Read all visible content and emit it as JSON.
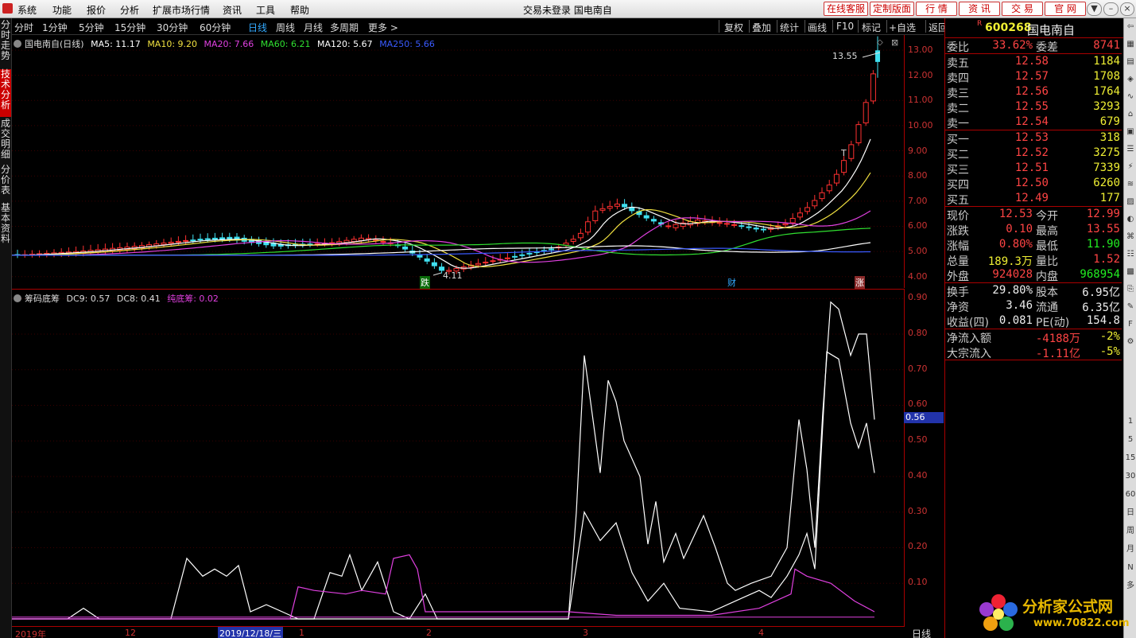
{
  "menubar": {
    "items": [
      "系统",
      "功能",
      "报价",
      "分析",
      "扩展市场行情",
      "资讯",
      "工具",
      "帮助"
    ],
    "title": "交易未登录  国电南自",
    "buttons": [
      "在线客服",
      "定制版面",
      "行 情",
      "资 讯",
      "交 易",
      "官 网"
    ]
  },
  "left_tabs": [
    "分时走势",
    "技术分析",
    "成交明细",
    "分价表",
    "基本资料"
  ],
  "periods": [
    "分时",
    "1分钟",
    "5分钟",
    "15分钟",
    "30分钟",
    "60分钟",
    "日线",
    "周线",
    "月线",
    "多周期",
    "更多 >"
  ],
  "active_period": "日线",
  "right_tools": [
    "复权",
    "叠加",
    "统计",
    "画线",
    "F10",
    "标记",
    "+自选",
    "返回"
  ],
  "price_chart": {
    "legend": {
      "name": "国电南自(日线)",
      "ma": [
        {
          "label": "MA5: 11.17",
          "color": "#ffffff"
        },
        {
          "label": "MA10: 9.20",
          "color": "#f0e040"
        },
        {
          "label": "MA20: 7.66",
          "color": "#e040e0"
        },
        {
          "label": "MA60: 6.21",
          "color": "#30e030"
        },
        {
          "label": "MA120: 5.67",
          "color": "#ffffff"
        },
        {
          "label": "MA250: 5.66",
          "color": "#3a5aff"
        }
      ]
    },
    "y_ticks": [
      "13.00",
      "12.00",
      "11.00",
      "10.00",
      "9.00",
      "8.00",
      "7.00",
      "6.00",
      "5.00",
      "4.00"
    ],
    "high_label": "13.55",
    "low_label": "4.11",
    "markers": [
      "跌",
      "财",
      "涨"
    ],
    "t_marker": "T"
  },
  "indicator": {
    "legend": [
      {
        "label": "筹码底筹",
        "color": "#dddddd"
      },
      {
        "label": "DC9: 0.57",
        "color": "#dddddd"
      },
      {
        "label": "DC8: 0.41",
        "color": "#dddddd"
      },
      {
        "label": "纯底筹: 0.02",
        "color": "#e040e0"
      }
    ],
    "y_ticks": [
      "0.90",
      "0.80",
      "0.70",
      "0.60",
      "0.50",
      "0.40",
      "0.30",
      "0.20",
      "0.10"
    ],
    "cursor_value": "0.56"
  },
  "dates": {
    "labels": [
      "2019年",
      "12",
      "1",
      "2",
      "3",
      "4"
    ],
    "cursor": "2019/12/18/三",
    "period_label": "日线"
  },
  "quote": {
    "code": "600268",
    "name": "国电南自",
    "wei_bi": {
      "label": "委比",
      "value": "33.62%",
      "label2": "委差",
      "value2": "8741"
    },
    "asks": [
      {
        "label": "卖五",
        "price": "12.58",
        "vol": "1184"
      },
      {
        "label": "卖四",
        "price": "12.57",
        "vol": "1708"
      },
      {
        "label": "卖三",
        "price": "12.56",
        "vol": "1764"
      },
      {
        "label": "卖二",
        "price": "12.55",
        "vol": "3293"
      },
      {
        "label": "卖一",
        "price": "12.54",
        "vol": "679"
      }
    ],
    "bids": [
      {
        "label": "买一",
        "price": "12.53",
        "vol": "318"
      },
      {
        "label": "买二",
        "price": "12.52",
        "vol": "3275"
      },
      {
        "label": "买三",
        "price": "12.51",
        "vol": "7339"
      },
      {
        "label": "买四",
        "price": "12.50",
        "vol": "6260"
      },
      {
        "label": "买五",
        "price": "12.49",
        "vol": "177"
      }
    ],
    "stats": [
      {
        "l1": "现价",
        "v1": "12.53",
        "c1": "red",
        "l2": "今开",
        "v2": "12.99",
        "c2": "red"
      },
      {
        "l1": "涨跌",
        "v1": "0.10",
        "c1": "red",
        "l2": "最高",
        "v2": "13.55",
        "c2": "red"
      },
      {
        "l1": "涨幅",
        "v1": "0.80%",
        "c1": "red",
        "l2": "最低",
        "v2": "11.90",
        "c2": "green"
      },
      {
        "l1": "总量",
        "v1": "189.3万",
        "c1": "yellow",
        "l2": "量比",
        "v2": "1.52",
        "c2": "red"
      },
      {
        "l1": "外盘",
        "v1": "924028",
        "c1": "red",
        "l2": "内盘",
        "v2": "968954",
        "c2": "green"
      }
    ],
    "fin": [
      {
        "l1": "换手",
        "v1": "29.80%",
        "l2": "股本",
        "v2": "6.95亿"
      },
      {
        "l1": "净资",
        "v1": "3.46",
        "l2": "流通",
        "v2": "6.35亿"
      },
      {
        "l1": "收益(四)",
        "v1": "0.081",
        "l2": "PE(动)",
        "v2": "154.8"
      }
    ],
    "flows": [
      {
        "label": "净流入额",
        "v1": "-4188万",
        "v2": "-2%"
      },
      {
        "label": "大宗流入",
        "v1": "-1.11亿",
        "v2": "-5%"
      }
    ]
  },
  "icon_strip": [
    "1",
    "5",
    "15",
    "30",
    "60",
    "日",
    "周",
    "月",
    "N",
    "多"
  ],
  "watermark": {
    "text": "分析家公式网",
    "url": "www.70822.com"
  }
}
